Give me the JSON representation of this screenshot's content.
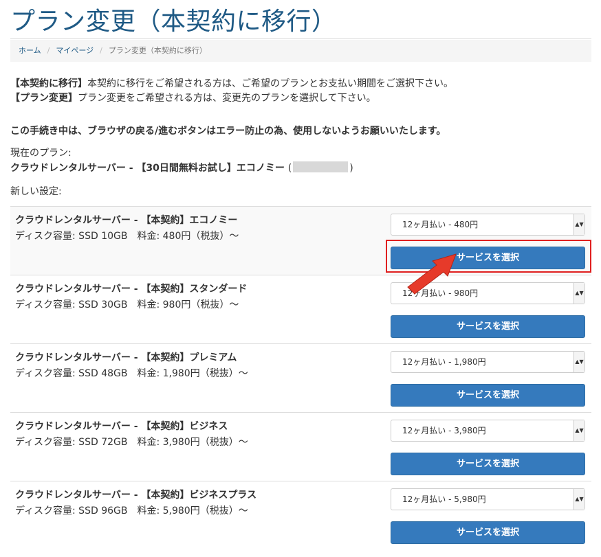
{
  "page": {
    "title": "プラン変更（本契約に移行）"
  },
  "breadcrumb": {
    "home": "ホーム",
    "mypage": "マイページ",
    "current": "プラン変更（本契約に移行）",
    "separator": "/"
  },
  "intro": {
    "line1_label": "【本契約に移行】",
    "line1_text": "本契約に移行をご希望される方は、ご希望のプランとお支払い期間をご選択下さい。",
    "line2_label": "【プラン変更】",
    "line2_text": "プラン変更をご希望される方は、変更先のプランを選択して下さい。"
  },
  "warning": "この手続き中は、ブラウザの戻る/進むボタンはエラー防止の為、使用しないようお願いいたします。",
  "current_plan": {
    "label": "現在のプラン:",
    "name": "クラウドレンタルサーバー - 【30日間無料お試し】エコノミー",
    "paren_open": "(",
    "paren_close": ")"
  },
  "new_settings_label": "新しい設定:",
  "select_arrow_icon": "▲▼",
  "plans": [
    {
      "name": "クラウドレンタルサーバー - 【本契約】エコノミー",
      "spec": "ディスク容量: SSD 10GB　料金: 480円（税抜）〜",
      "period": "12ヶ月払い - 480円",
      "button": "サービスを選択"
    },
    {
      "name": "クラウドレンタルサーバー - 【本契約】スタンダード",
      "spec": "ディスク容量: SSD 30GB　料金: 980円（税抜）〜",
      "period": "12ヶ月払い - 980円",
      "button": "サービスを選択"
    },
    {
      "name": "クラウドレンタルサーバー - 【本契約】プレミアム",
      "spec": "ディスク容量: SSD 48GB　料金: 1,980円（税抜）〜",
      "period": "12ヶ月払い - 1,980円",
      "button": "サービスを選択"
    },
    {
      "name": "クラウドレンタルサーバー - 【本契約】ビジネス",
      "spec": "ディスク容量: SSD 72GB　料金: 3,980円（税抜）〜",
      "period": "12ヶ月払い - 3,980円",
      "button": "サービスを選択"
    },
    {
      "name": "クラウドレンタルサーバー - 【本契約】ビジネスプラス",
      "spec": "ディスク容量: SSD 96GB　料金: 5,980円（税抜）〜",
      "period": "12ヶ月払い - 5,980円",
      "button": "サービスを選択"
    }
  ],
  "annotation": {
    "highlight_color": "#e02020",
    "arrow_color": "#e63a2a"
  },
  "colors": {
    "title": "#1f5a85",
    "button": "#357abd"
  }
}
